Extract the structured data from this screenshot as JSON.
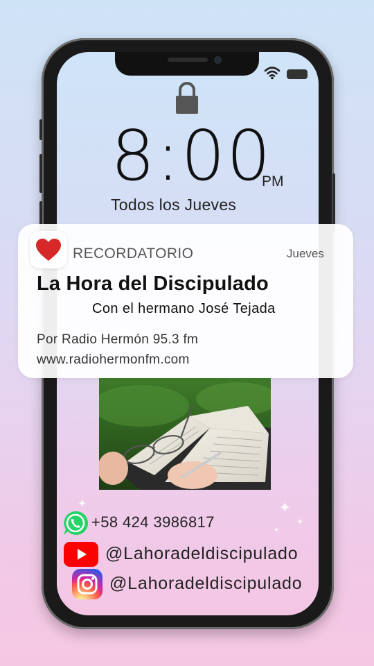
{
  "lockscreen": {
    "time": "8:00",
    "meridiem": "PM",
    "day": "Todos los Jueves"
  },
  "notification": {
    "app_name": "RECORDATORIO",
    "when": "Jueves",
    "title": "La Hora del Discipulado",
    "subtitle": "Con el hermano José Tejada",
    "line1": "Por Radio Hermón 95.3 fm",
    "line2": "www.radiohermonfm.com",
    "icon": "heart-icon",
    "icon_color": "#d62828"
  },
  "contacts": {
    "whatsapp": "+58 424 3986817",
    "youtube": "@Lahoradeldiscipulado",
    "instagram": "@Lahoradeldiscipulado"
  },
  "colors": {
    "whatsapp": "#25d366",
    "youtube": "#ff0000"
  }
}
